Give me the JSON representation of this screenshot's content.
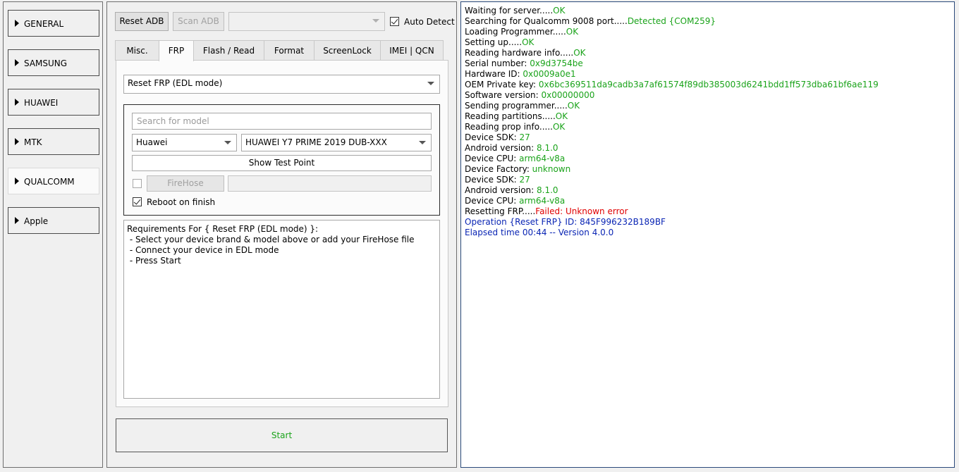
{
  "sidebar": {
    "items": [
      {
        "label": "GENERAL",
        "active": false
      },
      {
        "label": "SAMSUNG",
        "active": false
      },
      {
        "label": "HUAWEI",
        "active": false
      },
      {
        "label": "MTK",
        "active": false
      },
      {
        "label": "QUALCOMM",
        "active": true
      },
      {
        "label": "Apple",
        "active": false
      }
    ]
  },
  "toolbar": {
    "reset_adb": "Reset ADB",
    "scan_adb": "Scan ADB",
    "device_combo_value": "",
    "auto_detect_label": "Auto Detect",
    "auto_detect_checked": true
  },
  "tabs": [
    {
      "label": "Misc.",
      "active": false
    },
    {
      "label": "FRP",
      "active": true
    },
    {
      "label": "Flash / Read",
      "active": false
    },
    {
      "label": "Format",
      "active": false
    },
    {
      "label": "ScreenLock",
      "active": false
    },
    {
      "label": "IMEI | QCN",
      "active": false
    }
  ],
  "frp": {
    "operation_value": "Reset FRP (EDL mode)",
    "search_placeholder": "Search for model",
    "brand_value": "Huawei",
    "model_value": "HUAWEI Y7 PRIME 2019 DUB-XXX",
    "show_test_point": "Show Test Point",
    "firehose_checked": false,
    "firehose_label": "FireHose",
    "firehose_path": "",
    "reboot_label": "Reboot on finish",
    "reboot_checked": true,
    "requirements": [
      "Requirements For { Reset FRP (EDL mode) }:",
      " - Select your device brand & model above or add your FireHose file",
      " - Connect your device in EDL mode",
      " - Press Start"
    ],
    "start_label": "Start"
  },
  "colors": {
    "ok": "#1aa31a",
    "error": "#e00000",
    "info": "#0a25b4"
  },
  "log": [
    {
      "text": "Waiting for server.....",
      "value": "OK",
      "value_style": "ok"
    },
    {
      "text": "Searching for Qualcomm 9008 port.....",
      "value": "Detected {COM259}",
      "value_style": "ok"
    },
    {
      "text": "Loading Programmer.....",
      "value": "OK",
      "value_style": "ok"
    },
    {
      "text": "Setting up.....",
      "value": "OK",
      "value_style": "ok"
    },
    {
      "text": "Reading hardware info.....",
      "value": "OK",
      "value_style": "ok"
    },
    {
      "text": "Serial number: ",
      "value": "0x9d3754be",
      "value_style": "ok"
    },
    {
      "text": "Hardware ID: ",
      "value": "0x0009a0e1",
      "value_style": "ok"
    },
    {
      "text": "OEM Private key: ",
      "value": "0x6bc369511da9cadb3a7af61574f89db385003d6241bdd1ff573dba61bf6ae119",
      "value_style": "ok"
    },
    {
      "text": "Software version: ",
      "value": "0x00000000",
      "value_style": "ok"
    },
    {
      "text": "Sending programmer.....",
      "value": "OK",
      "value_style": "ok"
    },
    {
      "text": "Reading partitions.....",
      "value": "OK",
      "value_style": "ok"
    },
    {
      "text": "Reading prop info.....",
      "value": "OK",
      "value_style": "ok"
    },
    {
      "text": "Device SDK: ",
      "value": "27",
      "value_style": "ok"
    },
    {
      "text": "Android version: ",
      "value": "8.1.0",
      "value_style": "ok"
    },
    {
      "text": "Device CPU: ",
      "value": "arm64-v8a",
      "value_style": "ok"
    },
    {
      "text": "Device Factory: ",
      "value": "unknown",
      "value_style": "ok"
    },
    {
      "text": "Device SDK: ",
      "value": "27",
      "value_style": "ok"
    },
    {
      "text": "Android version: ",
      "value": "8.1.0",
      "value_style": "ok"
    },
    {
      "text": "Device CPU: ",
      "value": "arm64-v8a",
      "value_style": "ok"
    },
    {
      "text": "Resetting FRP.....",
      "value": "Failed: Unknown error",
      "value_style": "err"
    },
    {
      "text": "Operation {Reset FRP} ID: 845F996232B189BF",
      "value": "",
      "value_style": "blue",
      "text_style": "blue"
    },
    {
      "text": "Elapsed time 00:44 -- Version 4.0.0",
      "value": "",
      "value_style": "blue",
      "text_style": "blue"
    }
  ]
}
